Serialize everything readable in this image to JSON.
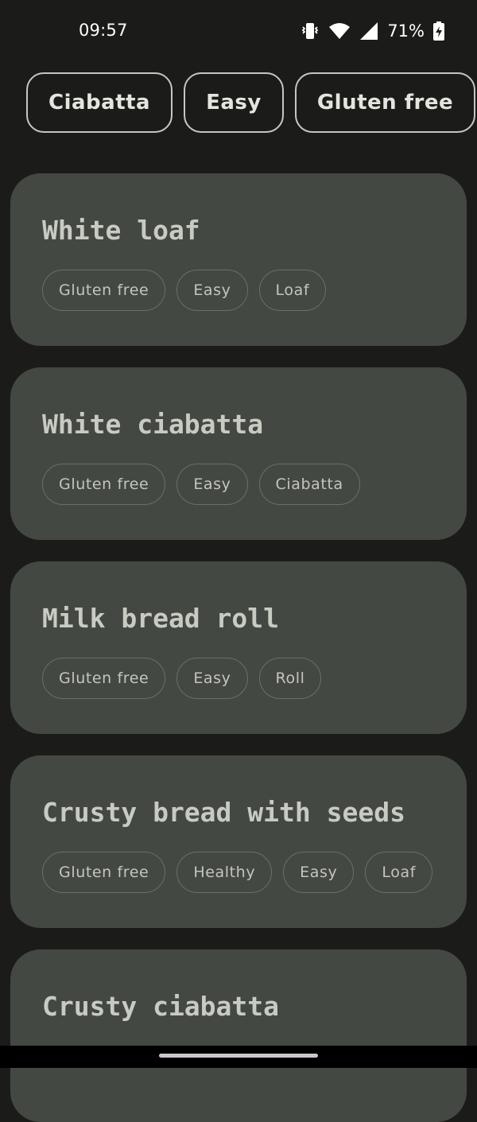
{
  "status_bar": {
    "time": "09:57",
    "battery_percent": "71%",
    "icons": [
      "vibrate-icon",
      "wifi-icon",
      "cell-signal-icon",
      "battery-charging-icon"
    ]
  },
  "filters": [
    {
      "label": "Ciabatta"
    },
    {
      "label": "Easy"
    },
    {
      "label": "Gluten free"
    }
  ],
  "recipes": [
    {
      "title": "White loaf",
      "tags": [
        "Gluten free",
        "Easy",
        "Loaf"
      ]
    },
    {
      "title": "White ciabatta",
      "tags": [
        "Gluten free",
        "Easy",
        "Ciabatta"
      ]
    },
    {
      "title": "Milk bread roll",
      "tags": [
        "Gluten free",
        "Easy",
        "Roll"
      ]
    },
    {
      "title": "Crusty bread with seeds",
      "tags": [
        "Gluten free",
        "Healthy",
        "Easy",
        "Loaf"
      ]
    },
    {
      "title": "Crusty ciabatta",
      "tags": []
    }
  ],
  "colors": {
    "background": "#1b1c1a",
    "card": "#444842",
    "chip_border": "#c5c8c0",
    "tag_border": "#6a6f67",
    "title_text": "#c8cbc2"
  }
}
